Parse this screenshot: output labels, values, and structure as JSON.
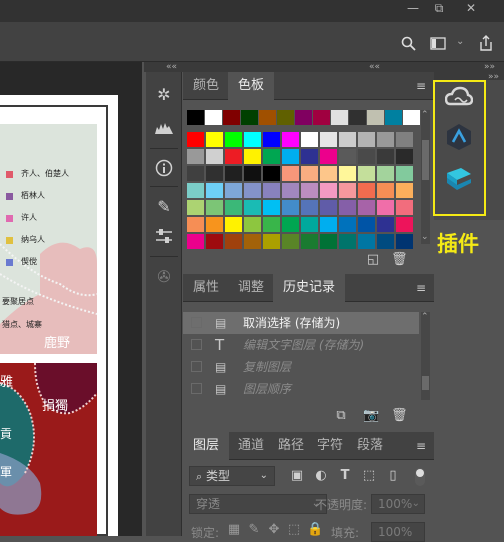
{
  "window_controls": {
    "minimize": "—",
    "restore": "⧉",
    "close": "✕"
  },
  "options_bar": {
    "search_icon": "search-icon",
    "workspace_icon": "workspace-icon",
    "share_icon": "share-icon"
  },
  "map_legend": {
    "items": [
      {
        "label": "齐人、伯楚人",
        "color": "#e05a6a"
      },
      {
        "label": "栢林人",
        "color": "#8a5aa0"
      },
      {
        "label": "许人",
        "color": "#e06ab0"
      },
      {
        "label": "纳乌人",
        "color": "#e0c040"
      },
      {
        "label": "偰傥",
        "color": "#6a7ad0"
      }
    ],
    "notes": [
      "要聚居点",
      "猎点、城寨"
    ],
    "region_name": "鹿野"
  },
  "map2_labels": [
    "雅",
    "捐獨",
    "貢",
    "軍"
  ],
  "swatches_panel": {
    "tabs": [
      "颜色",
      "色板"
    ],
    "active_tab": "色板",
    "menu_label": "≡",
    "top_row": [
      "#000000",
      "#ffffff",
      "#800000",
      "#004000",
      "#a05000",
      "#606000",
      "#800060",
      "#a00040",
      "#e0e0e0",
      "#303030",
      "#c0c0b0",
      "#0080a0",
      "#ffffff"
    ],
    "rows": [
      [
        "#ff0000",
        "#ffff00",
        "#00ff00",
        "#00ffff",
        "#0000ff",
        "#ff00ff",
        "#ffffff",
        "#e6e6e6",
        "#cccccc",
        "#b3b3b3",
        "#999999",
        "#808080"
      ],
      [
        "#999999",
        "#d0d0d0",
        "#ed1c24",
        "#fff200",
        "#00a651",
        "#00aeef",
        "#2e3192",
        "#ec008c",
        "#5a5a5a",
        "#4a4a4a",
        "#3a3a3a",
        "#2a2a2a"
      ],
      [
        "#404040",
        "#303030",
        "#202020",
        "#101010",
        "#000000",
        "#f7977a",
        "#f9ad81",
        "#fdc68a",
        "#fff79a",
        "#c4df9b",
        "#a3d39c",
        "#82ca9d"
      ],
      [
        "#7bcdc8",
        "#6ecff6",
        "#7ea7d8",
        "#8493ca",
        "#8882be",
        "#a187be",
        "#bc8dbf",
        "#f49ac2",
        "#f6989d",
        "#f26c4f",
        "#f68e55",
        "#fbaf5c"
      ],
      [
        "#acd372",
        "#7cc576",
        "#3bb878",
        "#1abbb4",
        "#00bff3",
        "#438cca",
        "#5574b9",
        "#605ca8",
        "#855fa8",
        "#a763a8",
        "#f06ea9",
        "#f26d7d"
      ],
      [
        "#f68e55",
        "#f7941d",
        "#fff200",
        "#8dc63f",
        "#39b54a",
        "#00a651",
        "#00a99d",
        "#00aeef",
        "#0072bc",
        "#0054a6",
        "#2e3192",
        "#ed145b"
      ],
      [
        "#ec008c",
        "#9e0b0f",
        "#a0410d",
        "#a36209",
        "#aba000",
        "#598527",
        "#1a7b30",
        "#007236",
        "#00746b",
        "#0076a3",
        "#004b80",
        "#003471"
      ]
    ]
  },
  "history_panel": {
    "tabs": [
      "属性",
      "调整",
      "历史记录"
    ],
    "active_tab": "历史记录",
    "menu_label": "≡",
    "items": [
      {
        "label": "取消选择 (存储为)",
        "state": "selected"
      },
      {
        "label": "编辑文字图层 (存储为)",
        "state": "undone"
      },
      {
        "label": "复制图层",
        "state": "undone"
      },
      {
        "label": "图层顺序",
        "state": "undone"
      }
    ]
  },
  "layers_panel": {
    "tabs": [
      "图层",
      "通道",
      "路径",
      "字符",
      "段落"
    ],
    "active_tab": "图层",
    "menu_label": "≡",
    "filter_label": "类型",
    "blend_mode": "穿透",
    "opacity_label": "不透明度:",
    "opacity_value": "100%",
    "lock_label": "锁定:",
    "fill_label": "填充:",
    "fill_value": "100%"
  },
  "plugins": {
    "label": "插件",
    "items": [
      "creative-cloud-icon",
      "plugin-a-icon",
      "plugin-layers-icon"
    ],
    "highlight_color": "#f5ea15"
  }
}
